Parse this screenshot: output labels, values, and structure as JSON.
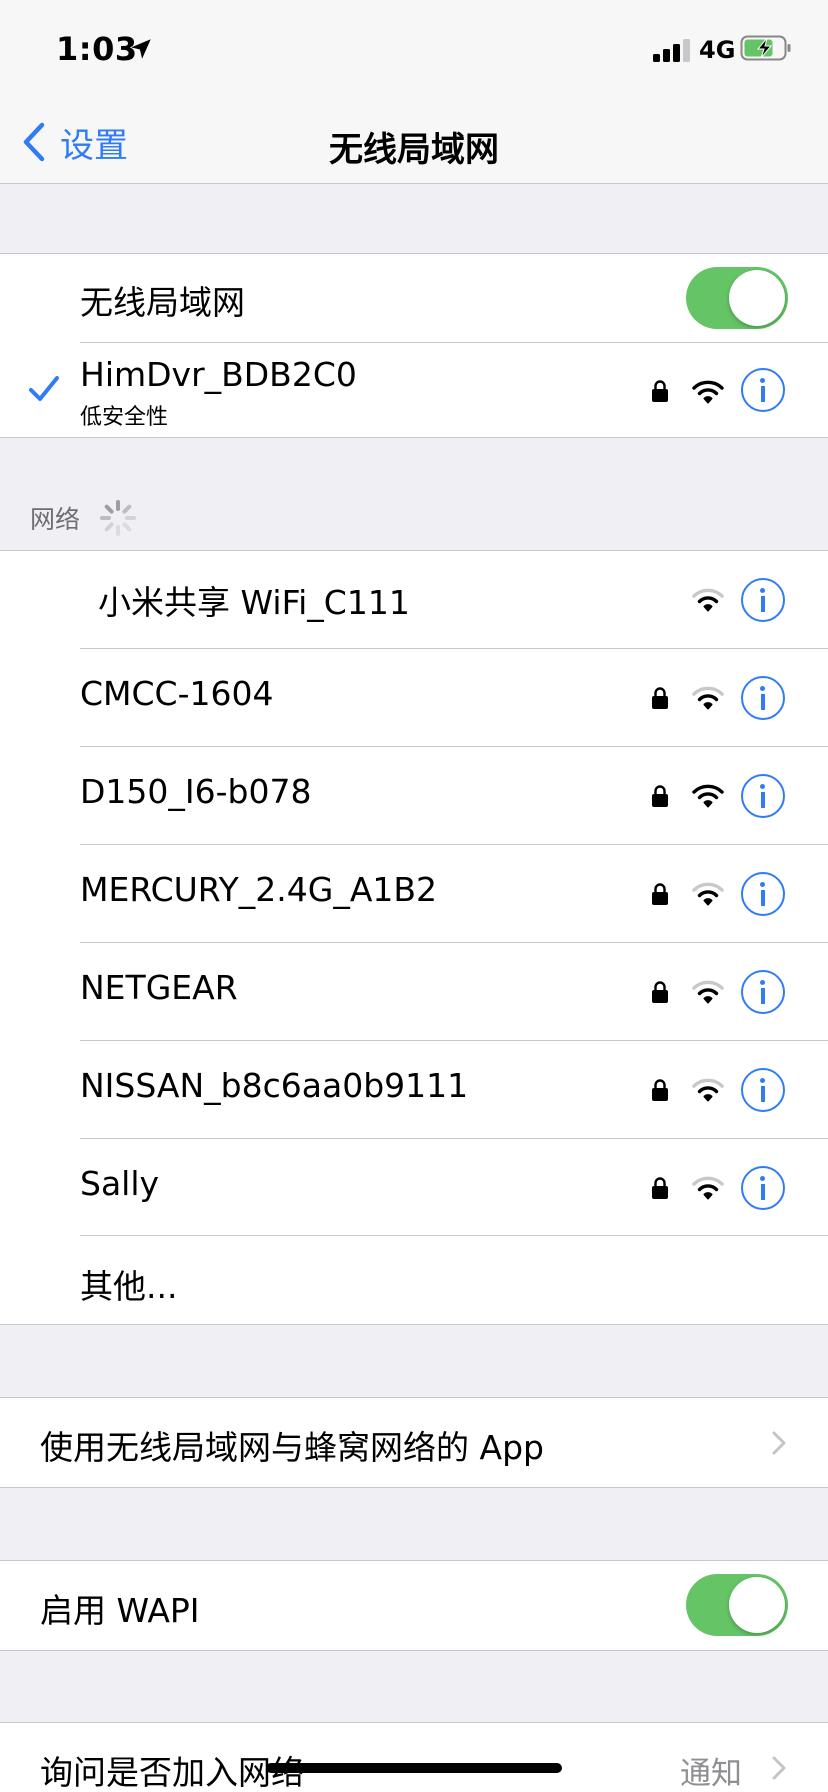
{
  "status_bar": {
    "time": "1:03",
    "network": "4G"
  },
  "nav": {
    "back_label": "设置",
    "title": "无线局域网"
  },
  "wifi_toggle_row": {
    "label": "无线局域网",
    "enabled": true
  },
  "connected": {
    "name": "HimDvr_BDB2C0",
    "subtitle": "低安全性",
    "secured": true,
    "signal": 3
  },
  "networks_header": "网络",
  "networks": [
    {
      "name": "小米共享 WiFi_C111",
      "secured": false,
      "signal": 2
    },
    {
      "name": "CMCC-1604",
      "secured": true,
      "signal": 2
    },
    {
      "name": "D150_I6-b078",
      "secured": true,
      "signal": 3
    },
    {
      "name": "MERCURY_2.4G_A1B2",
      "secured": true,
      "signal": 2
    },
    {
      "name": "NETGEAR",
      "secured": true,
      "signal": 2
    },
    {
      "name": "NISSAN_b8c6aa0b9111",
      "secured": true,
      "signal": 2
    },
    {
      "name": "Sally",
      "secured": true,
      "signal": 2
    }
  ],
  "other_label": "其他...",
  "apps_row": {
    "label": "使用无线局域网与蜂窝网络的 App"
  },
  "wapi_row": {
    "label": "启用 WAPI",
    "enabled": true
  },
  "ask_row": {
    "label": "询问是否加入网络",
    "value": "通知"
  },
  "colors": {
    "accent": "#2f7cf6",
    "toggle_on": "#65c466",
    "separator": "#c8c7cc",
    "background": "#efeff4"
  }
}
